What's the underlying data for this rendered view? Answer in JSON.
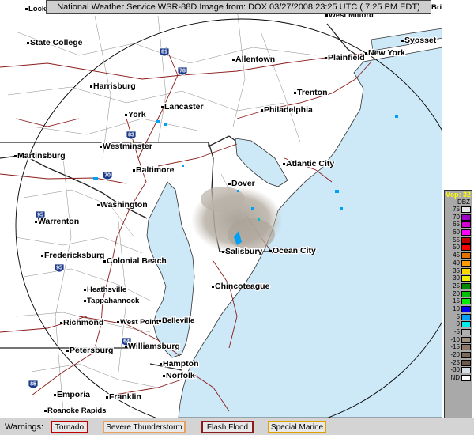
{
  "header": {
    "text": "National Weather Service WSR-88D Image from: DOX 03/27/2008 23:25 UTC ( 7:25 PM EDT)"
  },
  "map": {
    "cities": [
      {
        "name": "State College"
      },
      {
        "name": "Allentown"
      },
      {
        "name": "Harrisburg"
      },
      {
        "name": "Lancaster"
      },
      {
        "name": "Trenton"
      },
      {
        "name": "York"
      },
      {
        "name": "Philadelphia"
      },
      {
        "name": "Westminster"
      },
      {
        "name": "Martinsburg"
      },
      {
        "name": "Baltimore"
      },
      {
        "name": "Atlantic City"
      },
      {
        "name": "Dover"
      },
      {
        "name": "Washington"
      },
      {
        "name": "Warrenton"
      },
      {
        "name": "Ocean City"
      },
      {
        "name": "Salisbury"
      },
      {
        "name": "Fredericksburg"
      },
      {
        "name": "Colonial Beach"
      },
      {
        "name": "Chincoteague"
      },
      {
        "name": "Heathsville"
      },
      {
        "name": "Tappahannock"
      },
      {
        "name": "Richmond"
      },
      {
        "name": "West Point"
      },
      {
        "name": "Belleville"
      },
      {
        "name": "Petersburg"
      },
      {
        "name": "Williamsburg"
      },
      {
        "name": "Hampton"
      },
      {
        "name": "Norfolk"
      },
      {
        "name": "Emporia"
      },
      {
        "name": "Franklin"
      },
      {
        "name": "Roanoke Rapids"
      },
      {
        "name": "Plainfield"
      },
      {
        "name": "New York"
      },
      {
        "name": "Syosset"
      },
      {
        "name": "West Milford"
      },
      {
        "name": "Bridgeport"
      },
      {
        "name": "Lock Haven"
      }
    ],
    "highways": [
      "81",
      "78",
      "83",
      "70",
      "95",
      "64",
      "85"
    ]
  },
  "legend": {
    "title": "Vcp: 32",
    "unit": "DBZ",
    "rows": [
      {
        "value": "75",
        "color": "#e8e8e8"
      },
      {
        "value": "70",
        "color": "#a000c8"
      },
      {
        "value": "65",
        "color": "#d000d0"
      },
      {
        "value": "60",
        "color": "#ff00ff"
      },
      {
        "value": "55",
        "color": "#c00000"
      },
      {
        "value": "50",
        "color": "#ff0000"
      },
      {
        "value": "45",
        "color": "#e47000"
      },
      {
        "value": "40",
        "color": "#ff9c00"
      },
      {
        "value": "35",
        "color": "#ffd800"
      },
      {
        "value": "30",
        "color": "#eeee00"
      },
      {
        "value": "25",
        "color": "#008800"
      },
      {
        "value": "20",
        "color": "#00c000"
      },
      {
        "value": "15",
        "color": "#00ee00"
      },
      {
        "value": "10",
        "color": "#0000ee"
      },
      {
        "value": "5",
        "color": "#00a0f6"
      },
      {
        "value": "0",
        "color": "#00eeee"
      },
      {
        "value": "-5",
        "color": "#b0b0b0"
      },
      {
        "value": "-10",
        "color": "#a09080"
      },
      {
        "value": "-15",
        "color": "#907868"
      },
      {
        "value": "-20",
        "color": "#806858"
      },
      {
        "value": "-25",
        "color": "#705848"
      },
      {
        "value": "-30",
        "color": "#d8e0e8"
      },
      {
        "value": "ND",
        "color": "#ffffff"
      }
    ]
  },
  "warnings": {
    "label": "Warnings:",
    "items": [
      {
        "label": "Tornado",
        "color": "#c00000"
      },
      {
        "label": "Severe Thunderstorm",
        "color": "#e8a060"
      },
      {
        "label": "Flash Flood",
        "color": "#8b1a1a"
      },
      {
        "label": "Special Marine",
        "color": "#e0a000"
      }
    ]
  }
}
